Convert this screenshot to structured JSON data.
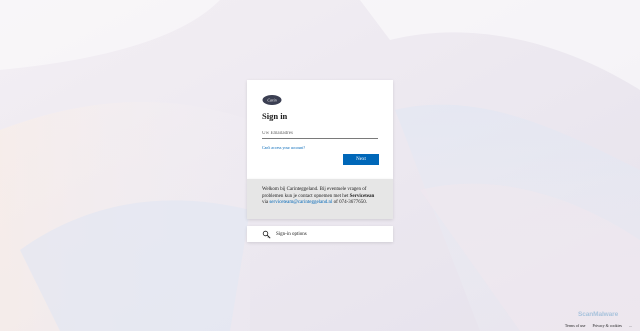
{
  "signin": {
    "title": "Sign in",
    "email_placeholder": "Uw Emailadres",
    "cant_access_link": "Can't access your account?",
    "next_button": "Next"
  },
  "info": {
    "text_before": "Welkom bij Carinteggeland. Bij eventuele vragen of problemen kun je contact opnemen met het ",
    "servicedesk": "Servicetean",
    "text_via": " via ",
    "email": "serviceteam@carinteggeland.nl",
    "text_after": " of 074-3677650."
  },
  "options": {
    "label": "Sign-in options",
    "icon": "key-search-icon"
  },
  "footer": {
    "terms": "Terms of use",
    "privacy": "Privacy & cookies",
    "more": "..."
  },
  "watermark": "ScanMalware",
  "colors": {
    "accent": "#0067b8",
    "info_bg": "#e6e6e6"
  }
}
